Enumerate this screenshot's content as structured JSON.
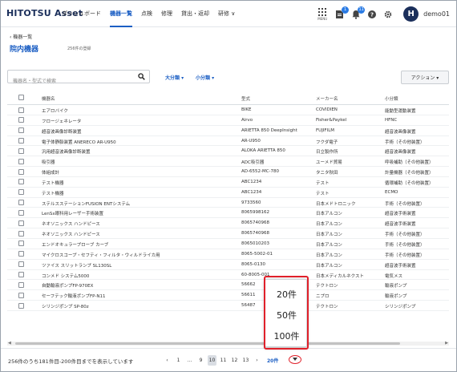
{
  "header": {
    "logo": "HITOTSU Asset",
    "nav": [
      {
        "label": "ダッシュボード"
      },
      {
        "label": "機器一覧"
      },
      {
        "label": "点検"
      },
      {
        "label": "修理"
      },
      {
        "label": "貸出・返却"
      },
      {
        "label": "研修 ∨"
      }
    ],
    "menu_label": "MENU",
    "doc_badge": "1",
    "bell_badge": "11",
    "avatar_letter": "H",
    "user_name": "demo01"
  },
  "page": {
    "back_label": "‹ 機器一覧",
    "title": "院内機器",
    "count_label": "256件の登録"
  },
  "toolbar": {
    "search_placeholder": "機器名・型式で検索",
    "filter_major": "大分類 ▾",
    "filter_minor": "小分類 ▾",
    "action_label": "アクション ▾"
  },
  "table": {
    "columns": [
      "機器名",
      "型式",
      "メーカー名",
      "小分類"
    ],
    "rows": [
      [
        "エアロバイク",
        "BIKE",
        "COVIDIEN",
        "能動型運動装置"
      ],
      [
        "フロージェネレータ",
        "Airvo",
        "Fisher&Paykel",
        "HFNC"
      ],
      [
        "超音波画像診断装置",
        "ARIETTA 850 DeepInsight",
        "FUJIFILM",
        "超音波画像装置"
      ],
      [
        "電子体静脈装置 ANERECO AR-U950",
        "AR-U950",
        "フクダ電子",
        "手術（その他装置）"
      ],
      [
        "汎用超音波画像診断装置",
        "ALOKA ARIETTA 850",
        "日立製作所",
        "超音波画像装置"
      ],
      [
        "吸引器",
        "ADC吸引器",
        "ユーメド貿易",
        "呼吸補助（その他装置）"
      ],
      [
        "体組成計",
        "AD-6552-MC-780",
        "タニタ秋田",
        "計量機器（その他装置）"
      ],
      [
        "テスト機器",
        "ABC1234",
        "テスト",
        "循環補助（その他装置）"
      ],
      [
        "テスト機器",
        "ABC1234",
        "テスト",
        "ECMO"
      ],
      [
        "ステルスステーションFUSION ENTシステム",
        "9733560",
        "日本メドトロニック",
        "手術（その他装置）"
      ],
      [
        "LenSx眼科用レーザー手術装置",
        "8065998162",
        "日本アルコン",
        "超音波手術装置"
      ],
      [
        "ネオソニックス ハンドピース",
        "8065740968",
        "日本アルコン",
        "超音波手術装置"
      ],
      [
        "ネオソニックス ハンドピース",
        "8065740968",
        "日本アルコン",
        "手術（その他装置）"
      ],
      [
        "エンドオキュラープローブ カーブ",
        "8065010203",
        "日本アルコン",
        "手術（その他装置）"
      ],
      [
        "マイクロスコープ・セフティ・フィルタ・ウィルドライカ用",
        "8065-5002-01",
        "日本アルコン",
        "手術（その他装置）"
      ],
      [
        "ツァイス スリットランプ SL130SL",
        "8065-0130",
        "日本アルコン",
        "超音波手術装置"
      ],
      [
        "コンメド システム5000",
        "60-8005-001",
        "日本メディカルネクスト",
        "電気メス"
      ],
      [
        "自動輸液ポンプFP-970EX",
        "56662",
        "テクトロン",
        "輸液ポンプ"
      ],
      [
        "セーフテック輸液ポンプFP-N11",
        "56611",
        "ニプロ",
        "輸液ポンプ"
      ],
      [
        "シリンジポンプ SP-80z",
        "56487",
        "テクトロン",
        "シリンジポンプ"
      ]
    ]
  },
  "footer": {
    "range_text": "256件のうち181件目-200件目までを表示しています",
    "pages": [
      "‹",
      "1",
      "...",
      "9",
      "10",
      "11",
      "12",
      "13",
      "›"
    ],
    "current_page": "10",
    "per_page": "20件"
  },
  "per_page_dropdown": {
    "options": [
      "20件",
      "50件",
      "100件"
    ]
  }
}
